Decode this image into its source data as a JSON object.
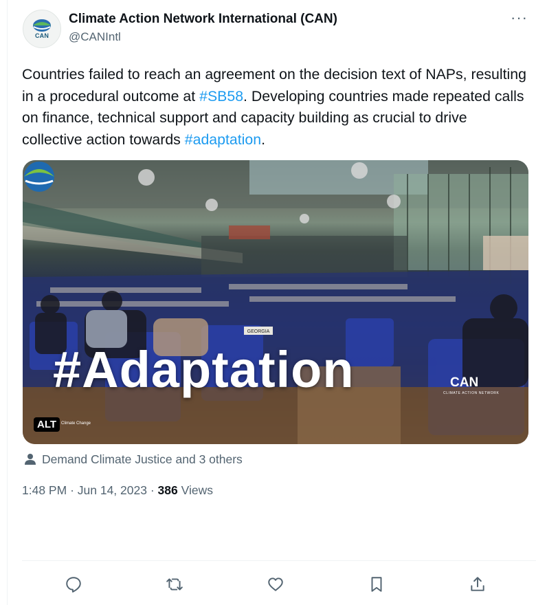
{
  "author": {
    "display_name": "Climate Action Network International (CAN)",
    "handle": "@CANIntl",
    "avatar_text": "CAN"
  },
  "menu": {
    "more_label": "···"
  },
  "tweet": {
    "text_part1": "Countries failed to reach an agreement on the decision text of NAPs, resulting in a procedural outcome at ",
    "hashtag1": "#SB58",
    "text_part2": ". Developing countries made repeated calls on finance, technical support and capacity building as crucial to drive collective action towards ",
    "hashtag2": "#adaptation",
    "text_part3": "."
  },
  "media": {
    "overlay_text": "#Adaptation",
    "logo_text": "CAN",
    "logo_subtext": "CLIMATE ACTION NETWORK",
    "alt_label": "ALT",
    "alt_side_text": "Climate Change"
  },
  "tagged": {
    "text": "Demand Climate Justice and 3 others"
  },
  "meta": {
    "time": "1:48 PM",
    "separator": "·",
    "date": "Jun 14, 2023",
    "views_count": "386",
    "views_label": "Views"
  },
  "actions": [
    {
      "name": "reply",
      "icon": "reply-icon"
    },
    {
      "name": "retweet",
      "icon": "retweet-icon"
    },
    {
      "name": "like",
      "icon": "heart-icon"
    },
    {
      "name": "bookmark",
      "icon": "bookmark-icon"
    },
    {
      "name": "share",
      "icon": "share-icon"
    }
  ],
  "colors": {
    "link": "#1d9bf0",
    "text": "#0f1419",
    "secondary": "#536471",
    "divider": "#eff3f4"
  }
}
